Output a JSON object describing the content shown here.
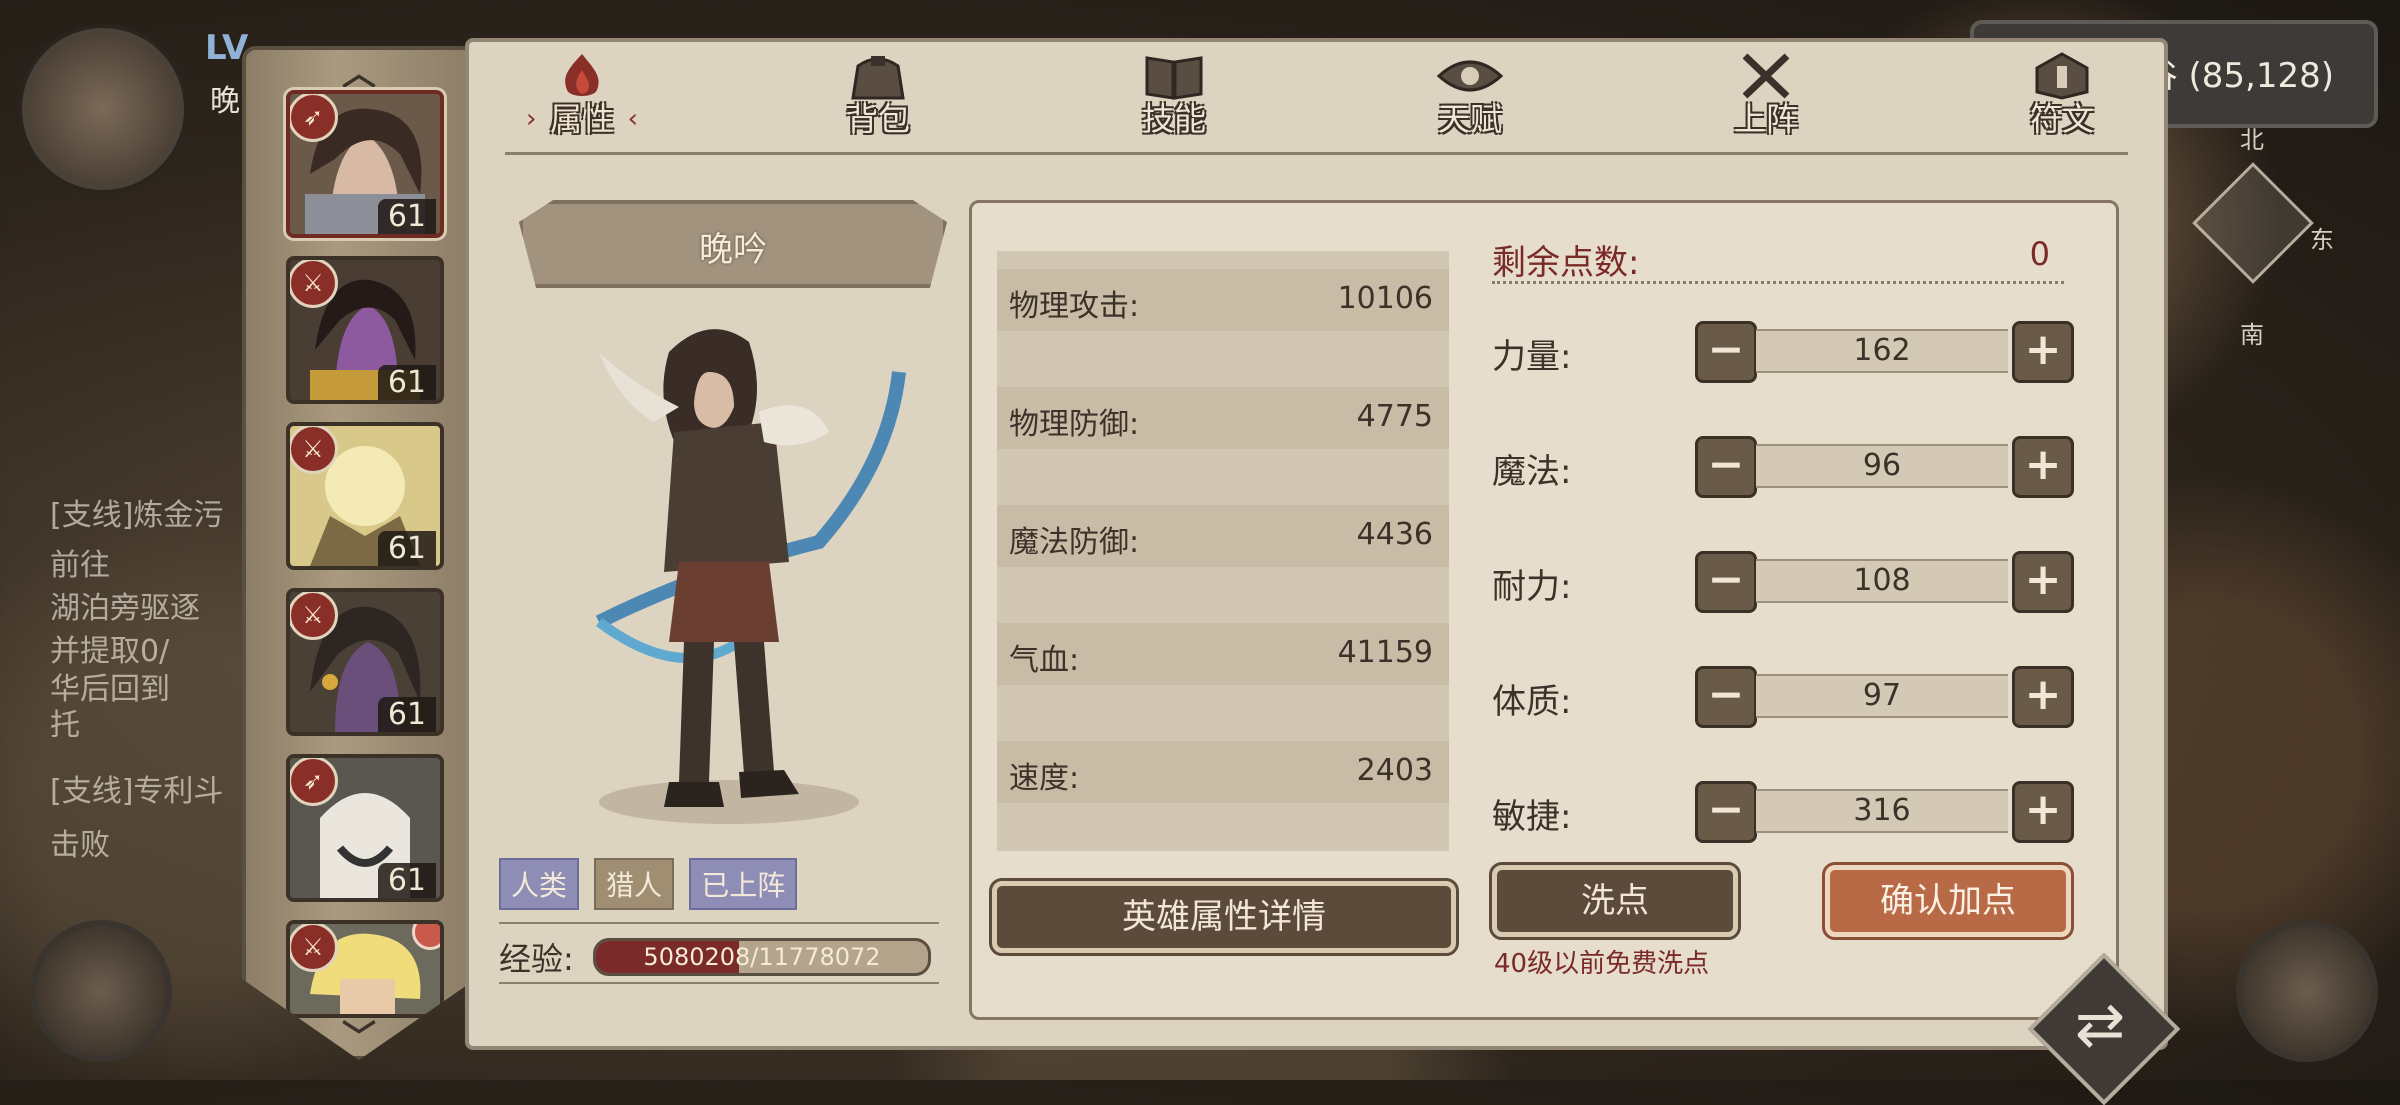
{
  "hud": {
    "level_prefix": "LV",
    "name_initial": "晚",
    "coords": "谷 (85,128)"
  },
  "compass": {
    "north": "北",
    "east": "东",
    "south": "南"
  },
  "quests": [
    {
      "text": "[支线]炼金污"
    },
    {
      "text": "前往"
    },
    {
      "text": "湖泊旁驱逐"
    },
    {
      "text": "并提取0/"
    },
    {
      "text": "华后回到"
    },
    {
      "text": "托"
    },
    {
      "text": "[支线]专利斗"
    },
    {
      "text": "击败"
    }
  ],
  "sidebar": {
    "heroes": [
      {
        "level": "61",
        "selected": true
      },
      {
        "level": "61"
      },
      {
        "level": "61"
      },
      {
        "level": "61"
      },
      {
        "level": "61"
      },
      {
        "level": ""
      }
    ]
  },
  "tabs": [
    {
      "label": "属性",
      "icon": "flame-icon",
      "active": true
    },
    {
      "label": "背包",
      "icon": "bag-icon"
    },
    {
      "label": "技能",
      "icon": "book-icon"
    },
    {
      "label": "天赋",
      "icon": "eye-icon"
    },
    {
      "label": "上阵",
      "icon": "crossed-swords-icon"
    },
    {
      "label": "符文",
      "icon": "rune-icon"
    }
  ],
  "hero": {
    "name": "晚吟",
    "tags": [
      "人类",
      "猎人",
      "已上阵"
    ],
    "exp_label": "经验:",
    "exp_text": "5080208/11778072",
    "exp_fraction": 0.431
  },
  "stats": [
    {
      "name": "物理攻击:",
      "value": "10106"
    },
    {
      "name": "物理防御:",
      "value": "4775"
    },
    {
      "name": "魔法防御:",
      "value": "4436"
    },
    {
      "name": "气血:",
      "value": "41159"
    },
    {
      "name": "速度:",
      "value": "2403"
    }
  ],
  "detail_button": "英雄属性详情",
  "allocation": {
    "remaining_label": "剩余点数:",
    "remaining_value": "0",
    "attributes": [
      {
        "name": "力量:",
        "value": "162"
      },
      {
        "name": "魔法:",
        "value": "96"
      },
      {
        "name": "耐力:",
        "value": "108"
      },
      {
        "name": "体质:",
        "value": "97"
      },
      {
        "name": "敏捷:",
        "value": "316"
      }
    ],
    "minus_symbol": "−",
    "plus_symbol": "+"
  },
  "reset_button": "洗点",
  "reset_note": "40级以前免费洗点",
  "confirm_button": "确认加点",
  "colors": {
    "accent_red": "#7a2a28",
    "confirm": "#b86a47",
    "panel": "#ddd3c1"
  }
}
